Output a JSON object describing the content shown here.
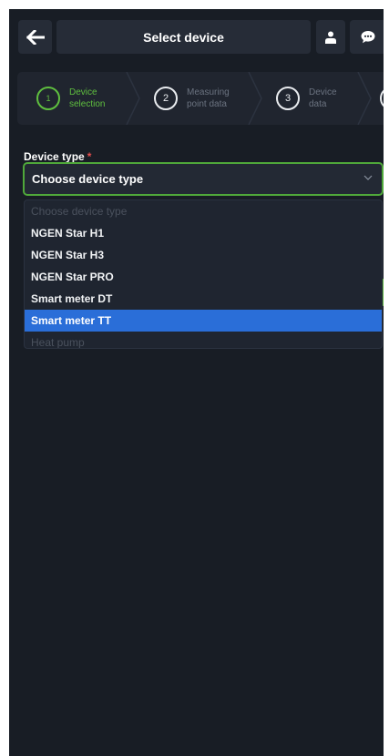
{
  "header": {
    "title": "Select device",
    "back_icon": "arrow-left-icon",
    "user_icon": "user-icon",
    "chat_icon": "chat-bubble-icon"
  },
  "stepper": {
    "steps": [
      {
        "number": "1",
        "label": "Device\nselection",
        "state": "active"
      },
      {
        "number": "2",
        "label": "Measuring\npoint data",
        "state": "inactive"
      },
      {
        "number": "3",
        "label": "Device\ndata",
        "state": "inactive"
      }
    ],
    "active_color": "#5fbf3f"
  },
  "form": {
    "device_type_label": "Device type",
    "required_marker": "*",
    "selected_value": "Choose device type",
    "caret_icon": "chevron-down-icon"
  },
  "dropdown": {
    "options": [
      {
        "label": "Choose device type",
        "state": "disabled"
      },
      {
        "label": "NGEN Star H1",
        "state": "normal"
      },
      {
        "label": "NGEN Star H3",
        "state": "normal"
      },
      {
        "label": "NGEN Star PRO",
        "state": "normal"
      },
      {
        "label": "Smart meter DT",
        "state": "normal"
      },
      {
        "label": "Smart meter TT",
        "state": "highlighted"
      },
      {
        "label": "Heat pump",
        "state": "disabled"
      }
    ],
    "highlight_color": "#2a6ed8"
  }
}
